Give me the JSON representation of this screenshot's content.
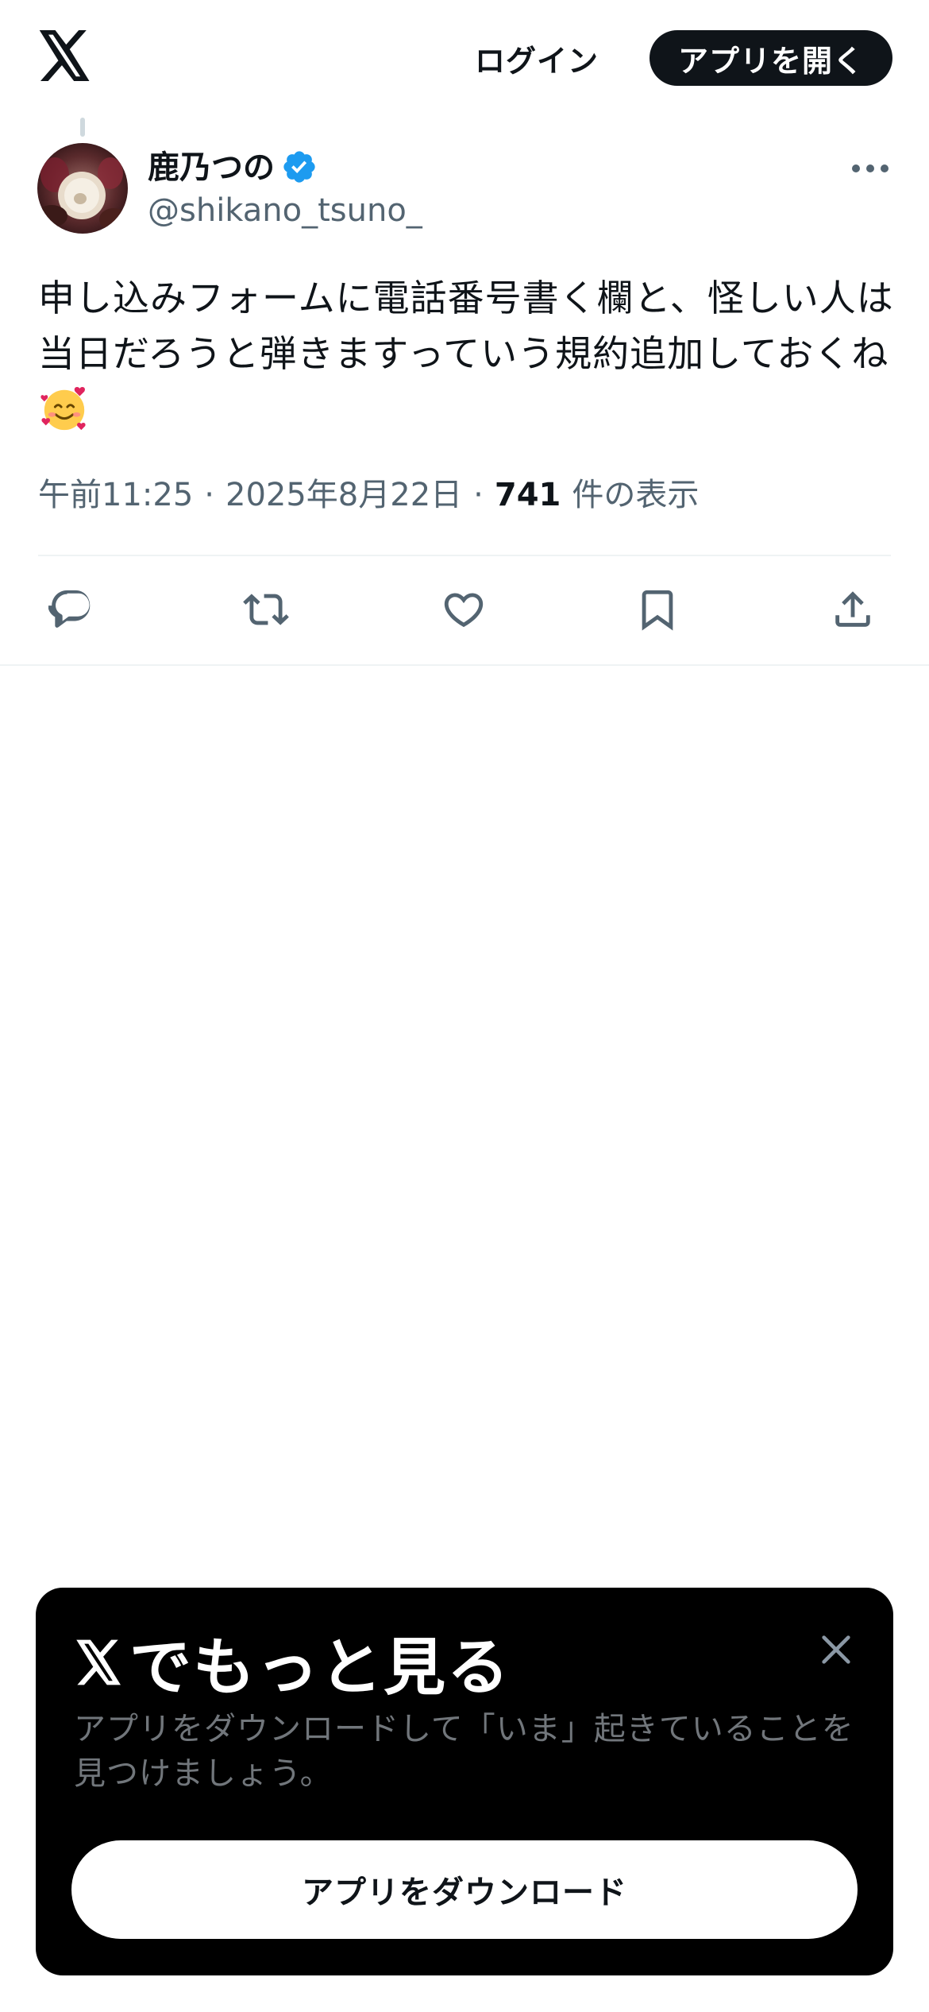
{
  "header": {
    "logo_icon": "x-logo-icon",
    "login_label": "ログイン",
    "open_app_label": "アプリを開く"
  },
  "tweet": {
    "author": {
      "display_name": "鹿乃つの",
      "verified": true,
      "verified_color": "#1d9bf0",
      "handle": "@shikano_tsuno_"
    },
    "text": "申し込みフォームに電話番号書く欄と、怪しい人は当日だろうと弾きますっていう規約追加しておくね",
    "emoji": "smiling-face-with-hearts-emoji",
    "time": "午前11:25",
    "date": "2025年8月22日",
    "view_count": "741",
    "view_label": "件の表示",
    "separator": "·",
    "actions": [
      "reply-icon",
      "retweet-icon",
      "like-icon",
      "bookmark-icon",
      "share-icon"
    ]
  },
  "promo": {
    "title": "でもっと見る",
    "description": "アプリをダウンロードして「いま」起きていることを見つけましょう。",
    "download_label": "アプリをダウンロード",
    "close_icon": "close-icon"
  },
  "colors": {
    "text_primary": "#0f1419",
    "text_secondary": "#536471",
    "promo_bg": "#000000",
    "promo_desc": "#71767b",
    "divider": "#eff3f4"
  }
}
